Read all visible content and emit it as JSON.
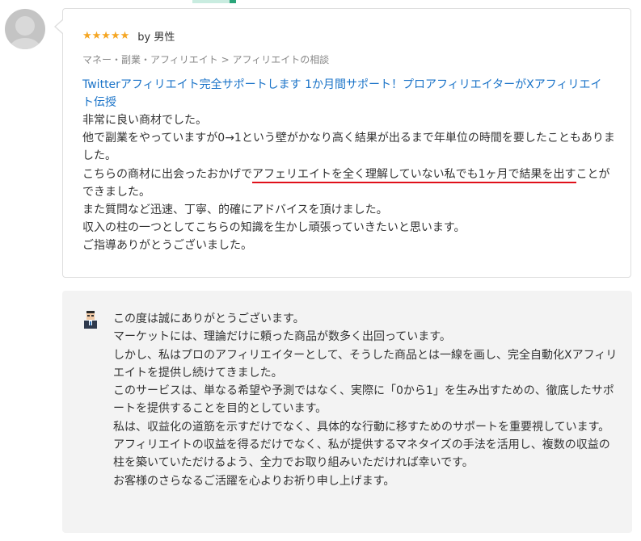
{
  "review": {
    "stars": "★★★★★",
    "rating": 5,
    "by": "by 男性",
    "breadcrumb": "マネー・副業・アフィリエイト > アフィリエイトの相談",
    "service_title": "Twitterアフィリエイト完全サポートします 1か月間サポート！プロアフィリエイターがXアフィリエイト伝授",
    "lines": [
      "非常に良い商材でした。",
      "他で副業をやっていますが0→1という壁がかなり高く結果が出るまで年単位の時間を要したこともありました。"
    ],
    "highlight_line": {
      "before": "こちらの商材に出会ったおかげで",
      "highlight": "アフェリエイトを全く理解していない私でも1ヶ月で結果を出す",
      "after": "ことができました。"
    },
    "lines_after": [
      "また質問など迅速、丁寧、的確にアドバイスを頂けました。",
      "収入の柱の一つとしてこちらの知識を生かし頑張っていきたいと思います。",
      "ご指導ありがとうございました。"
    ]
  },
  "reply": {
    "lines": [
      "この度は誠にありがとうございます。",
      "マーケットには、理論だけに頼った商品が数多く出回っています。",
      "しかし、私はプロのアフィリエイターとして、そうした商品とは一線を画し、完全自動化Xアフィリエイトを提供し続けてきました。",
      "このサービスは、単なる希望や予測ではなく、実際に「0から1」を生み出すための、徹底したサポートを提供することを目的としています。",
      "私は、収益化の道筋を示すだけでなく、具体的な行動に移すためのサポートを重要視しています。",
      "アフィリエイトの収益を得るだけでなく、私が提供するマネタイズの手法を活用し、複数の収益の柱を築いていただけるよう、全力でお取り組みいただければ幸いです。",
      "お客様のさらなるご活躍を心よりお祈り申し上げます。"
    ]
  },
  "colors": {
    "link": "#1a73c8",
    "star": "#f5a623",
    "highlight_underline": "#e0101a",
    "reply_bg": "#f3f3f3"
  }
}
